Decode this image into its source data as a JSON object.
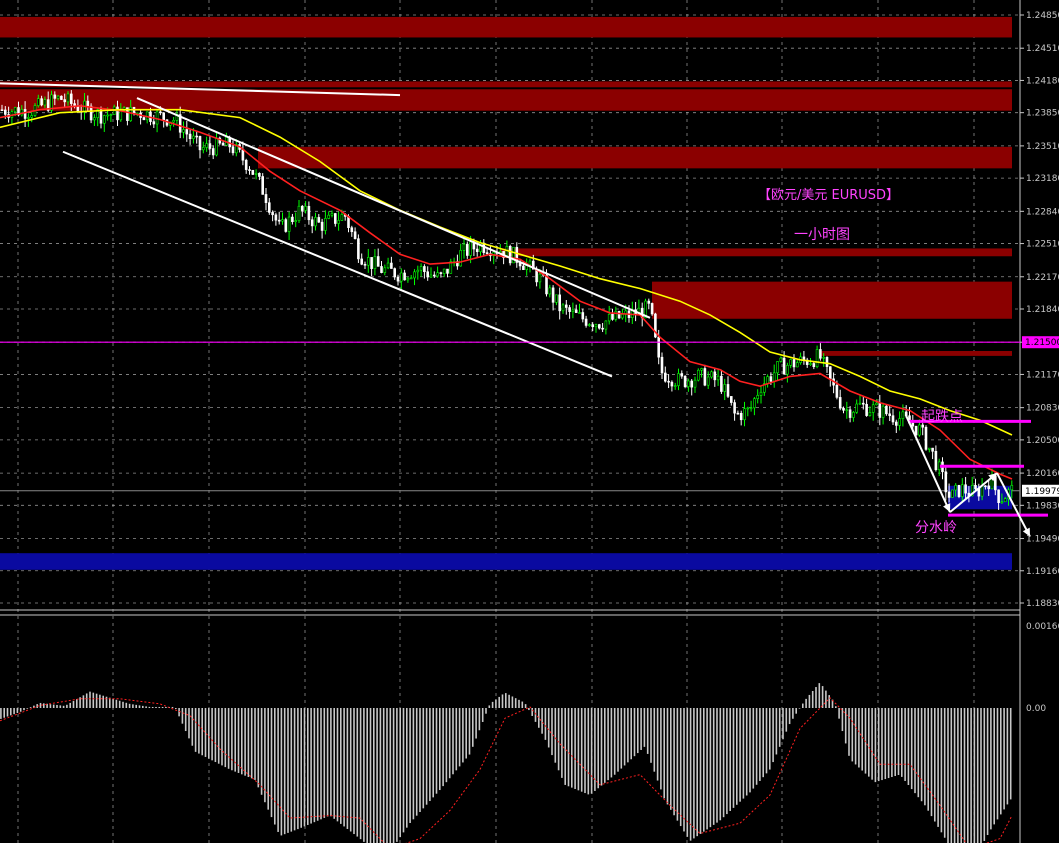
{
  "colors": {
    "background": "#000000",
    "grid": "#c0c0c0",
    "resistance_zone": "#8b0000",
    "support_zone": "#0a0aa0",
    "ma_fast": "#ff2020",
    "ma_slow": "#ffff00",
    "trendline": "#ffffff",
    "level_line": "#ff00ff",
    "annotation": "#ff44ff",
    "candle_up": "#00ff00",
    "candle_down": "#ffffff",
    "macd_hist": "#c8c8c8",
    "macd_signal": "#ff2020",
    "axis_text": "#c8c8c8",
    "current_price_box": "#ffffff"
  },
  "annotations": {
    "title": "【欧元/美元 EURUSD】",
    "subtitle": "一小时图",
    "start_point": "起跌点",
    "watershed": "分水岭"
  },
  "chart_data": [
    {
      "type": "candlestick",
      "panel": "price",
      "symbol": "EURUSD",
      "timeframe": "H1",
      "ylim": [
        1.1883,
        1.2485
      ],
      "yticks": [
        "1.24850",
        "1.24510",
        "1.24180",
        "1.23850",
        "1.23510",
        "1.23180",
        "1.22840",
        "1.22510",
        "1.22170",
        "1.21840",
        "1.21500",
        "1.21170",
        "1.20830",
        "1.20500",
        "1.20160",
        "1.19830",
        "1.19490",
        "1.19160",
        "1.18830"
      ],
      "current_price": "1.19979",
      "marked_level": "1.21500",
      "close_path": [
        [
          0,
          1.2388
        ],
        [
          30,
          1.2387
        ],
        [
          60,
          1.24
        ],
        [
          80,
          1.239
        ],
        [
          100,
          1.2383
        ],
        [
          140,
          1.2385
        ],
        [
          175,
          1.2378
        ],
        [
          200,
          1.2348
        ],
        [
          230,
          1.2352
        ],
        [
          250,
          1.233
        ],
        [
          265,
          1.2302
        ],
        [
          280,
          1.2265
        ],
        [
          300,
          1.2285
        ],
        [
          320,
          1.227
        ],
        [
          345,
          1.228
        ],
        [
          360,
          1.224
        ],
        [
          380,
          1.2225
        ],
        [
          400,
          1.222
        ],
        [
          420,
          1.2225
        ],
        [
          440,
          1.2215
        ],
        [
          460,
          1.224
        ],
        [
          480,
          1.225
        ],
        [
          500,
          1.2245
        ],
        [
          520,
          1.2235
        ],
        [
          540,
          1.2215
        ],
        [
          560,
          1.2185
        ],
        [
          580,
          1.2175
        ],
        [
          600,
          1.217
        ],
        [
          630,
          1.2178
        ],
        [
          650,
          1.2185
        ],
        [
          660,
          1.212
        ],
        [
          680,
          1.211
        ],
        [
          700,
          1.2115
        ],
        [
          720,
          1.211
        ],
        [
          735,
          1.2075
        ],
        [
          750,
          1.208
        ],
        [
          760,
          1.2105
        ],
        [
          780,
          1.2125
        ],
        [
          800,
          1.213
        ],
        [
          820,
          1.2135
        ],
        [
          830,
          1.211
        ],
        [
          845,
          1.208
        ],
        [
          860,
          1.2085
        ],
        [
          880,
          1.208
        ],
        [
          905,
          1.207
        ],
        [
          920,
          1.206
        ],
        [
          935,
          1.203
        ],
        [
          950,
          1.199
        ],
        [
          960,
          1.2
        ],
        [
          975,
          1.1995
        ],
        [
          990,
          1.201
        ],
        [
          1000,
          1.199
        ],
        [
          1012,
          1.1998
        ]
      ],
      "series": [
        {
          "name": "",
          "kind": "moving_average",
          "color_key": "ma_fast",
          "points": [
            [
              0,
              1.238
            ],
            [
              40,
              1.2388
            ],
            [
              80,
              1.2392
            ],
            [
              120,
              1.2387
            ],
            [
              160,
              1.2378
            ],
            [
              200,
              1.2365
            ],
            [
              240,
              1.235
            ],
            [
              270,
              1.2325
            ],
            [
              300,
              1.2305
            ],
            [
              340,
              1.2285
            ],
            [
              370,
              1.2262
            ],
            [
              400,
              1.224
            ],
            [
              430,
              1.223
            ],
            [
              460,
              1.2232
            ],
            [
              490,
              1.224
            ],
            [
              520,
              1.2235
            ],
            [
              550,
              1.2215
            ],
            [
              580,
              1.2192
            ],
            [
              610,
              1.218
            ],
            [
              640,
              1.2178
            ],
            [
              660,
              1.2155
            ],
            [
              690,
              1.213
            ],
            [
              720,
              1.2122
            ],
            [
              740,
              1.211
            ],
            [
              760,
              1.2105
            ],
            [
              790,
              1.2115
            ],
            [
              820,
              1.2118
            ],
            [
              850,
              1.21
            ],
            [
              880,
              1.2088
            ],
            [
              910,
              1.208
            ],
            [
              940,
              1.206
            ],
            [
              970,
              1.203
            ],
            [
              1000,
              1.2015
            ],
            [
              1012,
              1.201
            ]
          ]
        },
        {
          "name": "",
          "kind": "moving_average",
          "color_key": "ma_slow",
          "points": [
            [
              0,
              1.237
            ],
            [
              60,
              1.2385
            ],
            [
              120,
              1.2388
            ],
            [
              180,
              1.2388
            ],
            [
              240,
              1.238
            ],
            [
              280,
              1.236
            ],
            [
              320,
              1.2335
            ],
            [
              360,
              1.2305
            ],
            [
              400,
              1.2285
            ],
            [
              440,
              1.2268
            ],
            [
              480,
              1.2252
            ],
            [
              520,
              1.224
            ],
            [
              560,
              1.2228
            ],
            [
              600,
              1.2215
            ],
            [
              640,
              1.2205
            ],
            [
              680,
              1.2192
            ],
            [
              710,
              1.2178
            ],
            [
              740,
              1.216
            ],
            [
              770,
              1.214
            ],
            [
              800,
              1.2132
            ],
            [
              830,
              1.2128
            ],
            [
              860,
              1.2115
            ],
            [
              890,
              1.21
            ],
            [
              920,
              1.2092
            ],
            [
              950,
              1.208
            ],
            [
              980,
              1.207
            ],
            [
              1012,
              1.2055
            ]
          ]
        }
      ],
      "trendlines": [
        {
          "from": [
            0,
            1.2415
          ],
          "to": [
            400,
            1.2403
          ],
          "color_key": "trendline"
        },
        {
          "from": [
            137,
            1.24
          ],
          "to": [
            650,
            1.2175
          ],
          "color_key": "trendline"
        },
        {
          "from": [
            63,
            1.2345
          ],
          "to": [
            612,
            1.2115
          ],
          "color_key": "trendline"
        }
      ],
      "zones": [
        {
          "y": [
            1.2462,
            1.2483
          ],
          "x": [
            0,
            1012
          ],
          "color_key": "resistance_zone"
        },
        {
          "y": [
            1.2387,
            1.2409
          ],
          "x": [
            0,
            1012
          ],
          "color_key": "resistance_zone"
        },
        {
          "y": [
            1.2411,
            1.2417
          ],
          "x": [
            0,
            1012
          ],
          "color_key": "resistance_zone"
        },
        {
          "y": [
            1.2328,
            1.235
          ],
          "x": [
            258,
            1012
          ],
          "color_key": "resistance_zone"
        },
        {
          "y": [
            1.2238,
            1.2246
          ],
          "x": [
            500,
            1012
          ],
          "color_key": "resistance_zone"
        },
        {
          "y": [
            1.2174,
            1.2212
          ],
          "x": [
            652,
            1012
          ],
          "color_key": "resistance_zone"
        },
        {
          "y": [
            1.2136,
            1.2141
          ],
          "x": [
            820,
            1012
          ],
          "color_key": "resistance_zone"
        },
        {
          "y": [
            1.1979,
            1.2003
          ],
          "x": [
            948,
            1012
          ],
          "color_key": "support_zone"
        },
        {
          "y": [
            1.1917,
            1.1934
          ],
          "x": [
            0,
            1012
          ],
          "color_key": "support_zone"
        }
      ],
      "key_levels": [
        {
          "y": 1.215,
          "x": [
            0,
            1020
          ],
          "color_key": "level_line",
          "width": 1.2
        },
        {
          "y": 1.2069,
          "x": [
            908,
            1031
          ],
          "color_key": "level_line",
          "width": 3
        },
        {
          "y": 1.2023,
          "x": [
            940,
            1024
          ],
          "color_key": "level_line",
          "width": 3
        },
        {
          "y": 1.1973,
          "x": [
            948,
            1048
          ],
          "color_key": "level_line",
          "width": 3
        }
      ],
      "arrows": [
        {
          "from": [
            906,
            1.2075
          ],
          "to": [
            950,
            1.1976
          ]
        },
        {
          "from": [
            950,
            1.1976
          ],
          "to": [
            997,
            1.2016
          ]
        },
        {
          "from": [
            997,
            1.2016
          ],
          "to": [
            1030,
            1.1951
          ]
        }
      ]
    },
    {
      "type": "bar",
      "panel": "macd",
      "ylim": [
        -0.0032,
        0.00166
      ],
      "yticks": [
        "0.00166",
        "0.00"
      ],
      "hist_path": [
        [
          0,
          -0.00022
        ],
        [
          20,
          -8e-05
        ],
        [
          40,
          0.0001
        ],
        [
          65,
          4e-05
        ],
        [
          90,
          0.00032
        ],
        [
          110,
          0.0002
        ],
        [
          130,
          8e-05
        ],
        [
          150,
          2e-05
        ],
        [
          175,
          2e-05
        ],
        [
          195,
          -0.00085
        ],
        [
          230,
          -0.0012
        ],
        [
          255,
          -0.0014
        ],
        [
          280,
          -0.0025
        ],
        [
          300,
          -0.00235
        ],
        [
          330,
          -0.0021
        ],
        [
          360,
          -0.00255
        ],
        [
          385,
          -0.00295
        ],
        [
          410,
          -0.00225
        ],
        [
          440,
          -0.0016
        ],
        [
          470,
          -0.0009
        ],
        [
          490,
          8e-05
        ],
        [
          505,
          0.0003
        ],
        [
          525,
          0.0001
        ],
        [
          545,
          -0.0006
        ],
        [
          565,
          -0.0015
        ],
        [
          590,
          -0.0017
        ],
        [
          615,
          -0.0013
        ],
        [
          645,
          -0.00075
        ],
        [
          665,
          -0.0018
        ],
        [
          690,
          -0.0026
        ],
        [
          720,
          -0.0022
        ],
        [
          750,
          -0.00165
        ],
        [
          770,
          -0.0012
        ],
        [
          790,
          -0.0003
        ],
        [
          805,
          0.00015
        ],
        [
          820,
          0.0005
        ],
        [
          835,
          0.0001
        ],
        [
          850,
          -0.001
        ],
        [
          875,
          -0.00145
        ],
        [
          900,
          -0.0013
        ],
        [
          925,
          -0.0019
        ],
        [
          950,
          -0.0027
        ],
        [
          970,
          -0.0031
        ],
        [
          990,
          -0.0024
        ],
        [
          1012,
          -0.00175
        ]
      ],
      "signal_path": [
        [
          0,
          -0.00025
        ],
        [
          40,
          5e-05
        ],
        [
          80,
          0.00018
        ],
        [
          120,
          0.00018
        ],
        [
          160,
          8e-05
        ],
        [
          190,
          -0.00015
        ],
        [
          220,
          -0.0008
        ],
        [
          260,
          -0.0015
        ],
        [
          290,
          -0.00215
        ],
        [
          330,
          -0.0021
        ],
        [
          360,
          -0.00215
        ],
        [
          390,
          -0.00275
        ],
        [
          420,
          -0.00255
        ],
        [
          450,
          -0.002
        ],
        [
          480,
          -0.0012
        ],
        [
          505,
          -0.0002
        ],
        [
          530,
          2e-05
        ],
        [
          560,
          -0.0007
        ],
        [
          600,
          -0.0015
        ],
        [
          640,
          -0.0013
        ],
        [
          670,
          -0.0019
        ],
        [
          700,
          -0.00245
        ],
        [
          740,
          -0.00225
        ],
        [
          770,
          -0.0017
        ],
        [
          800,
          -0.0004
        ],
        [
          830,
          0.0002
        ],
        [
          850,
          -0.0002
        ],
        [
          880,
          -0.0011
        ],
        [
          910,
          -0.0011
        ],
        [
          940,
          -0.0019
        ],
        [
          970,
          -0.00275
        ],
        [
          1000,
          -0.00255
        ],
        [
          1012,
          -0.0021
        ]
      ]
    }
  ]
}
